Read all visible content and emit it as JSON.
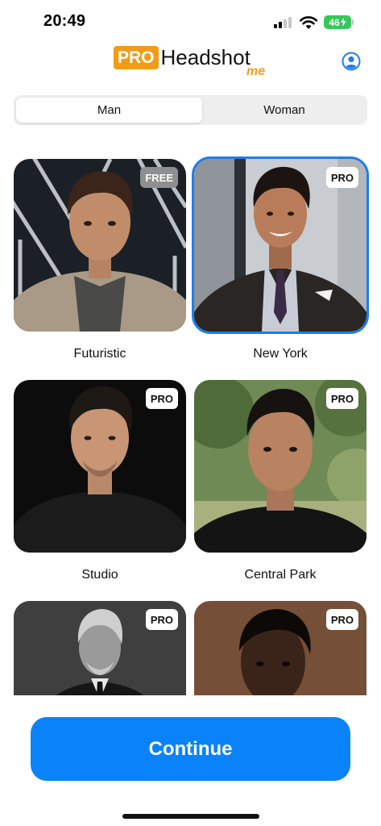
{
  "status_bar": {
    "time": "20:49",
    "battery": "46"
  },
  "header": {
    "logo_badge": "PRO",
    "logo_name": "Headshot",
    "logo_suffix": "me",
    "profile_icon": "person-circle-icon"
  },
  "gender_tabs": [
    {
      "label": "Man",
      "selected": true
    },
    {
      "label": "Woman",
      "selected": false
    }
  ],
  "styles": [
    {
      "name": "Futuristic",
      "badge": "FREE",
      "selected": false
    },
    {
      "name": "New York",
      "badge": "PRO",
      "selected": true
    },
    {
      "name": "Studio",
      "badge": "PRO",
      "selected": false
    },
    {
      "name": "Central Park",
      "badge": "PRO",
      "selected": false
    },
    {
      "name": "",
      "badge": "PRO",
      "selected": false
    },
    {
      "name": "",
      "badge": "PRO",
      "selected": false
    }
  ],
  "continue_button": {
    "label": "Continue"
  },
  "colors": {
    "accent": "#0a82fa",
    "brand_orange": "#f29b17",
    "selected_border": "#1e7dec"
  }
}
